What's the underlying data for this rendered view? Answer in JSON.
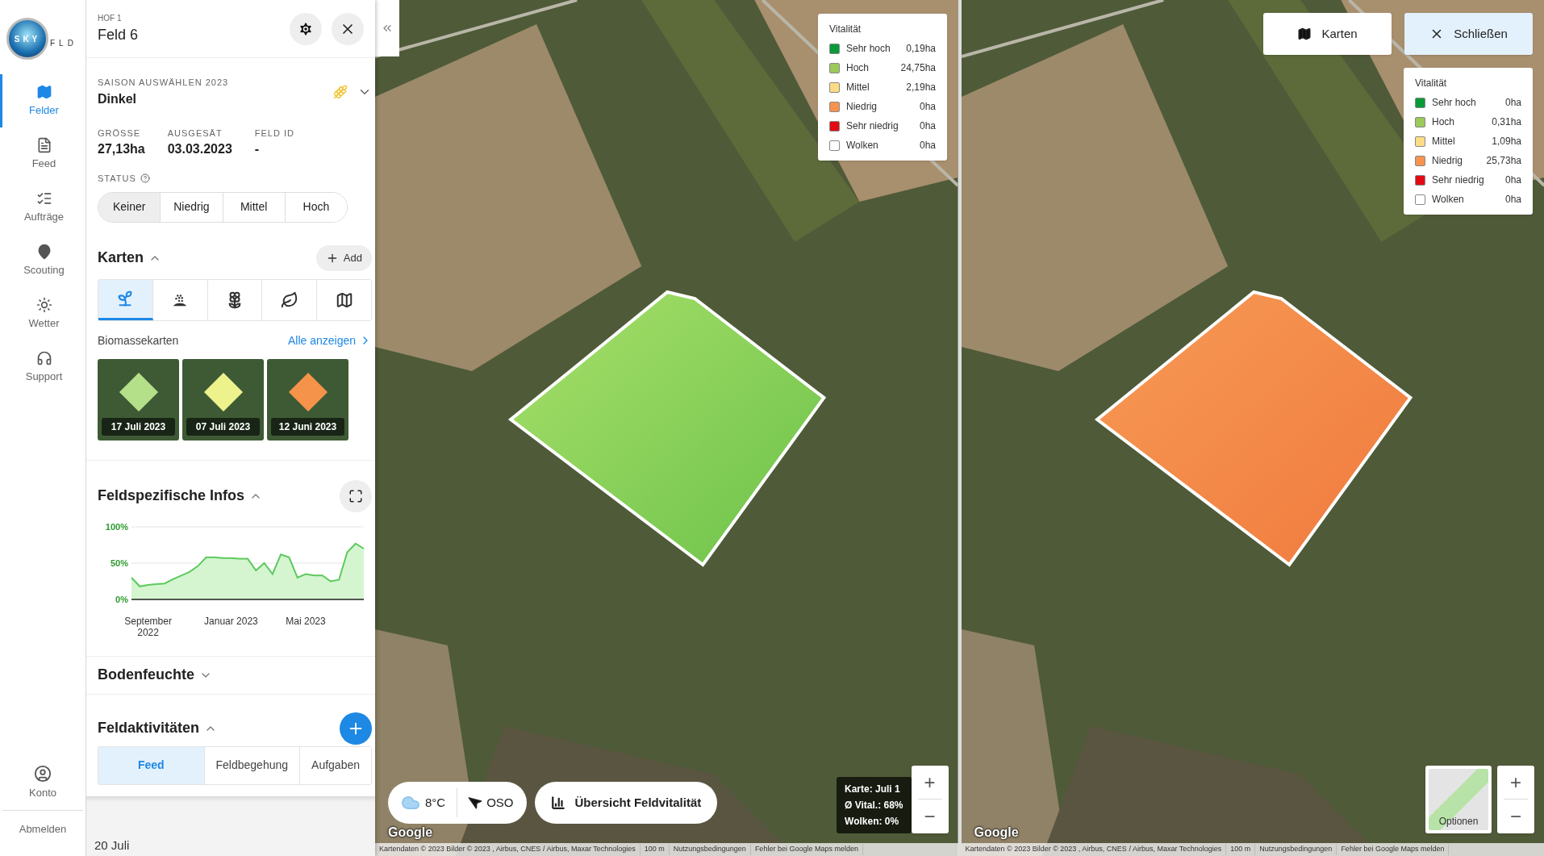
{
  "sidebar": {
    "logo": {
      "text_1": "SKY",
      "text_2": "FLD"
    },
    "nav": [
      {
        "label": "Felder",
        "selected": true
      },
      {
        "label": "Feed",
        "selected": false
      },
      {
        "label": "Aufträge",
        "selected": false
      },
      {
        "label": "Scouting",
        "selected": false
      },
      {
        "label": "Wetter",
        "selected": false
      },
      {
        "label": "Support",
        "selected": false
      }
    ],
    "account": "Konto",
    "logout": "Abmelden"
  },
  "panel": {
    "farm": "HOF 1",
    "field": "Feld 6",
    "season_label": "SAISON AUSWÄHLEN 2023",
    "crop": "Dinkel",
    "stats": [
      {
        "label": "GRÖSSE",
        "value": "27,13ha"
      },
      {
        "label": "AUSGESÄT",
        "value": "03.03.2023"
      },
      {
        "label": "FELD ID",
        "value": "-"
      }
    ],
    "status": {
      "label": "STATUS",
      "options": [
        {
          "label": "Keiner",
          "selected": true
        },
        {
          "label": "Niedrig",
          "selected": false
        },
        {
          "label": "Mittel",
          "selected": false
        },
        {
          "label": "Hoch",
          "selected": false
        }
      ]
    },
    "maps_section": {
      "title": "Karten",
      "expanded": true,
      "add": "Add",
      "tabs": [
        {
          "selected": true
        },
        {
          "selected": false
        },
        {
          "selected": false
        },
        {
          "selected": false
        },
        {
          "selected": false
        }
      ],
      "subtitle": "Biomassekarten",
      "show_all": "Alle anzeigen",
      "thumbnails": [
        {
          "date": "17 Juli 2023",
          "color": "#b5e08a"
        },
        {
          "date": "07 Juli 2023",
          "color": "#eef28c"
        },
        {
          "date": "12 Juni 2023",
          "color": "#f5934a"
        }
      ]
    },
    "info_section": {
      "title": "Feldspezifische Infos",
      "expanded": true,
      "chart_data": {
        "type": "area",
        "categories": [
          null,
          null,
          "September 2022",
          null,
          null,
          null,
          null,
          null,
          null,
          null,
          null,
          null,
          "Januar 2023",
          null,
          null,
          null,
          null,
          null,
          null,
          null,
          null,
          "Mai 2023",
          null,
          null,
          null,
          null,
          null,
          null,
          null
        ],
        "series": [
          {
            "color": "#5cc95c",
            "values": [
              30,
              18,
              20,
              21,
              22,
              28,
              33,
              38,
              46,
              58,
              58,
              57,
              57,
              56,
              56,
              40,
              50,
              35,
              62,
              58,
              30,
              35,
              33,
              33,
              25,
              27,
              65,
              77,
              70
            ]
          }
        ],
        "ylim": [
          0,
          100
        ],
        "yticks": [
          {
            "value": 0,
            "label": "0%"
          },
          {
            "value": 50,
            "label": "50%"
          },
          {
            "value": 100,
            "label": "100%"
          }
        ]
      }
    },
    "soil_section": {
      "title": "Bodenfeuchte",
      "expanded": false
    },
    "activities": {
      "title": "Feldaktivitäten",
      "expanded": true,
      "tabs": [
        {
          "label": "Feed",
          "selected": true
        },
        {
          "label": "Feldbegehung",
          "selected": false
        },
        {
          "label": "Aufgaben",
          "selected": false
        }
      ]
    },
    "feed_date": "20 Juli"
  },
  "maps": [
    {
      "kind": "vitality_green",
      "legend": {
        "title": "Vitalität",
        "items": [
          {
            "label": "Sehr hoch",
            "value": "0,19ha",
            "color": "#0a9a3a"
          },
          {
            "label": "Hoch",
            "value": "24,75ha",
            "color": "#9bc95a"
          },
          {
            "label": "Mittel",
            "value": "2,19ha",
            "color": "#fddc86"
          },
          {
            "label": "Niedrig",
            "value": "0ha",
            "color": "#f5934f"
          },
          {
            "label": "Sehr niedrig",
            "value": "0ha",
            "color": "#e30b13"
          },
          {
            "label": "Wolken",
            "value": "0ha",
            "color": "#ffffff"
          }
        ]
      },
      "weather": {
        "temperature": "8°C",
        "wind": "OSO"
      },
      "overview_button": "Übersicht Feldvitalität",
      "info": [
        "Karte: Juli 1",
        "Ø Vital.: 68%",
        "Wolken: 0%"
      ],
      "zoom": {
        "in": "+",
        "out": "−"
      },
      "google": "Google",
      "attribution": [
        "Kartendaten © 2023 Bilder © 2023 , Airbus, CNES / Airbus, Maxar Technologies",
        "100 m",
        "Nutzungsbedingungen",
        "Fehler bei Google Maps melden"
      ]
    },
    {
      "kind": "vitality_orange",
      "buttons": [
        {
          "label": "Karten"
        },
        {
          "label": "Schließen"
        }
      ],
      "legend": {
        "title": "Vitalität",
        "items": [
          {
            "label": "Sehr hoch",
            "value": "0ha",
            "color": "#0a9a3a"
          },
          {
            "label": "Hoch",
            "value": "0,31ha",
            "color": "#9bc95a"
          },
          {
            "label": "Mittel",
            "value": "1,09ha",
            "color": "#fddc86"
          },
          {
            "label": "Niedrig",
            "value": "25,73ha",
            "color": "#f5934f"
          },
          {
            "label": "Sehr niedrig",
            "value": "0ha",
            "color": "#e30b13"
          },
          {
            "label": "Wolken",
            "value": "0ha",
            "color": "#ffffff"
          }
        ]
      },
      "options": "Optionen",
      "zoom": {
        "in": "+",
        "out": "−"
      },
      "google": "Google",
      "attribution": [
        "Kartendaten © 2023 Bilder © 2023 , Airbus, CNES / Airbus, Maxar Technologies",
        "100 m",
        "Nutzungsbedingungen",
        "Fehler bei Google Maps melden"
      ]
    }
  ]
}
